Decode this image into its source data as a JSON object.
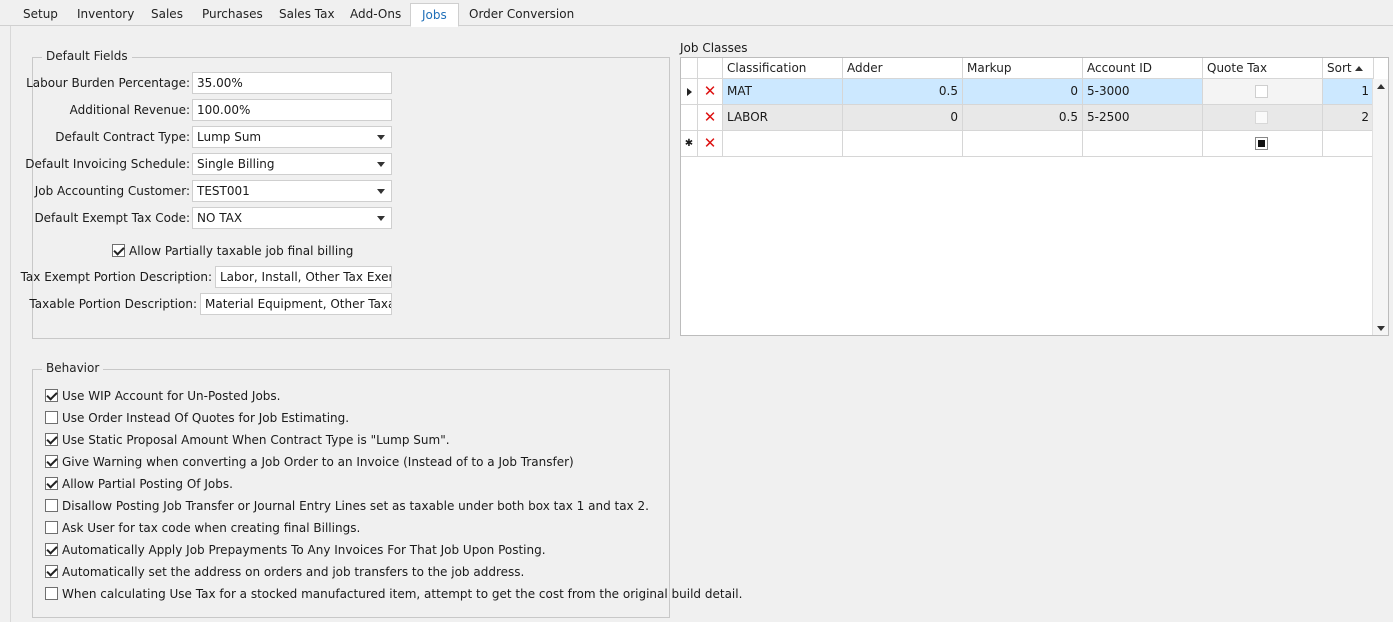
{
  "tabs": [
    "Setup",
    "Inventory",
    "Sales",
    "Purchases",
    "Sales Tax",
    "Add-Ons",
    "Jobs",
    "Order Conversion"
  ],
  "active_tab": "Jobs",
  "default_fields": {
    "title": "Default Fields",
    "labour_burden_label": "Labour Burden Percentage:",
    "labour_burden_value": "35.00%",
    "additional_revenue_label": "Additional Revenue:",
    "additional_revenue_value": "100.00%",
    "contract_type_label": "Default Contract Type:",
    "contract_type_value": "Lump Sum",
    "invoicing_schedule_label": "Default Invoicing Schedule:",
    "invoicing_schedule_value": "Single Billing",
    "accounting_customer_label": "Job Accounting Customer:",
    "accounting_customer_value": "TEST001",
    "exempt_tax_code_label": "Default Exempt Tax Code:",
    "exempt_tax_code_value": "NO TAX",
    "allow_partial_label": "Allow Partially taxable job final billing",
    "allow_partial_checked": true,
    "tax_exempt_desc_label": "Tax Exempt Portion Description:",
    "tax_exempt_desc_value": "Labor, Install, Other Tax Exempt",
    "taxable_desc_label": "Taxable Portion Description:",
    "taxable_desc_value": "Material Equipment, Other Taxable"
  },
  "behavior": {
    "title": "Behavior",
    "items": [
      {
        "label": "Use WIP Account for Un-Posted Jobs.",
        "checked": true
      },
      {
        "label": "Use Order Instead Of Quotes for Job Estimating.",
        "checked": false
      },
      {
        "label": "Use Static Proposal Amount When Contract Type is \"Lump Sum\".",
        "checked": true
      },
      {
        "label": "Give Warning when converting a Job Order to an Invoice (Instead of to a Job Transfer)",
        "checked": true
      },
      {
        "label": "Allow Partial Posting Of Jobs.",
        "checked": true
      },
      {
        "label": "Disallow Posting Job Transfer or Journal Entry Lines set as taxable under both box tax 1 and tax 2.",
        "checked": false
      },
      {
        "label": "Ask User for tax code when creating final Billings.",
        "checked": false
      },
      {
        "label": "Automatically Apply Job Prepayments To Any Invoices For That Job Upon Posting.",
        "checked": true
      },
      {
        "label": "Automatically set the address on orders and job transfers to the job address.",
        "checked": true
      },
      {
        "label": "When calculating Use Tax for a stocked manufactured item, attempt to get the cost from the original build detail.",
        "checked": false
      }
    ]
  },
  "job_classes": {
    "title": "Job Classes",
    "columns": [
      "Classification",
      "Adder",
      "Markup",
      "Account ID",
      "Quote Tax",
      "Sort"
    ],
    "rows": [
      {
        "classification": "MAT",
        "adder": "0.5",
        "markup": "0",
        "account_id": "5-3000",
        "quote_tax": false,
        "sort": "1"
      },
      {
        "classification": "LABOR",
        "adder": "0",
        "markup": "0.5",
        "account_id": "5-2500",
        "quote_tax": false,
        "sort": "2"
      }
    ]
  }
}
